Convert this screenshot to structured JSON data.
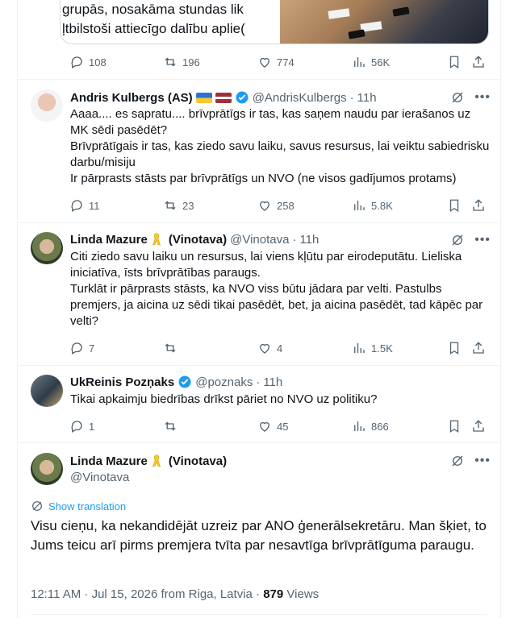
{
  "top_tweet": {
    "media_text_lines": [
      "grupās, nosakāma stundas lik",
      "ļtbilstoši attiecīgo dalību aplie("
    ],
    "stats": {
      "replies": "108",
      "reposts": "196",
      "likes": "774",
      "views": "56K"
    }
  },
  "replies": [
    {
      "name": "Andris Kulbergs (AS)",
      "flags": [
        "flag-ukraine",
        "flag-latvia"
      ],
      "verified": true,
      "handle": "@AndrisKulbergs",
      "time": "11h",
      "lines": [
        "Aaaa.... es sapratu.... brīvprātīgs ir tas, kas saņem naudu par ierašanos uz MK sēdi pasēdēt?",
        "Brīvprātīgais ir tas, kas ziedo savu laiku, savus resursus, lai veiktu sabiedrisku darbu/misiju",
        "Ir pārprasts stāsts par brīvprātīgs un NVO (ne visos gadījumos protams)"
      ],
      "stats": {
        "replies": "11",
        "reposts": "23",
        "likes": "258",
        "views": "5.8K"
      }
    },
    {
      "name": "Linda Mazure",
      "name_suffix": "(Vinotava)",
      "handle": "@Vinotava",
      "time": "11h",
      "lines": [
        "Citi ziedo savu laiku un resursus, lai viens kļūtu par eirodeputātu. Lieliska iniciatīva, īsts brīvprātības paraugs.",
        "Turklāt ir pārprasts stāsts, ka NVO viss būtu jādara par velti. Pastulbs premjers, ja aicina uz sēdi tikai pasēdēt, bet, ja aicina pasēdēt, tad kāpēc par velti?"
      ],
      "stats": {
        "replies": "7",
        "reposts": "",
        "likes": "4",
        "views": "1.5K"
      }
    },
    {
      "name": "UkReinis Pozņaks",
      "verified": true,
      "handle": "@poznaks",
      "time": "11h",
      "lines": [
        "Tikai apkaimju biedrības drīkst pāriet no NVO uz politiku?"
      ],
      "stats": {
        "replies": "1",
        "reposts": "",
        "likes": "45",
        "views": "866"
      }
    }
  ],
  "main_tweet": {
    "name": "Linda Mazure",
    "name_suffix": "(Vinotava)",
    "handle": "@Vinotava",
    "show_translation": "Show translation",
    "text": "Visu cieņu, ka nekandidējāt uzreiz par ANO ģenerālsekretāru. Man šķiet, to Jums teicu arī pirms premjera tvīta par nesavtīga brīvprātīguma paraugu.",
    "timestamp": "12:11 AM · Jul 15, 2026 from Riga, Latvia",
    "views_count": "879",
    "views_label": "Views"
  },
  "colors": {
    "text": "#0f1419",
    "muted": "#536471",
    "accent": "#1d9bf0",
    "verified": "#1d9bf0",
    "border": "#eff3f4"
  }
}
